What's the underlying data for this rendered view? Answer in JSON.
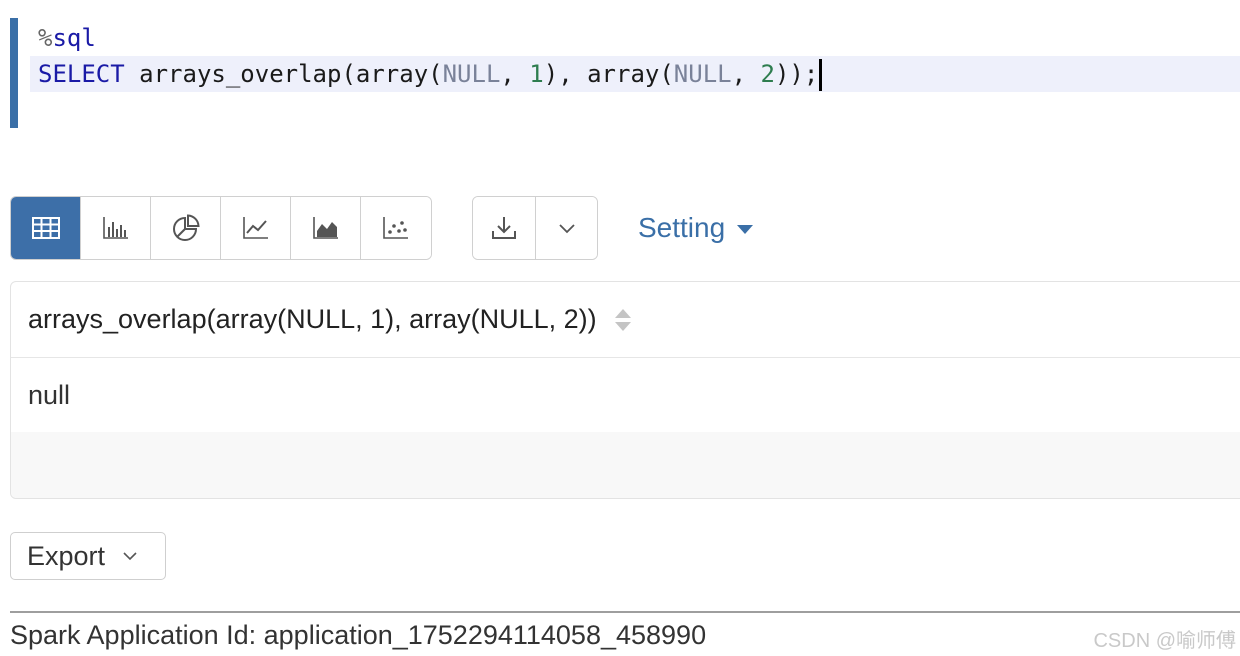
{
  "editor": {
    "magic_pct": "%",
    "magic": "sql",
    "tokens": {
      "kw": "SELECT",
      "fn1": " arrays_overlap(array(",
      "null1": "NULL",
      "sep1": ", ",
      "num1": "1",
      "mid": "), array(",
      "null2": "NULL",
      "sep2": ", ",
      "num2": "2",
      "end": "));"
    }
  },
  "toolbar": {
    "viz_buttons": [
      {
        "icon": "table-icon",
        "active": true
      },
      {
        "icon": "bar-chart-icon",
        "active": false
      },
      {
        "icon": "pie-chart-icon",
        "active": false
      },
      {
        "icon": "line-chart-icon",
        "active": false
      },
      {
        "icon": "area-chart-icon",
        "active": false
      },
      {
        "icon": "scatter-chart-icon",
        "active": false
      }
    ],
    "download_icon": "download-icon",
    "dropdown_icon": "chevron-down-icon",
    "setting_label": "Setting"
  },
  "table": {
    "columns": [
      "arrays_overlap(array(NULL, 1), array(NULL, 2))"
    ],
    "rows": [
      [
        "null"
      ]
    ]
  },
  "export": {
    "label": "Export"
  },
  "footer": {
    "app_id_text": "Spark Application Id: application_1752294114058_458990",
    "watermark": "CSDN @喻师傅"
  },
  "colors": {
    "accent": "#3a6fa7",
    "active_button": "#3d6fa8",
    "line_highlight": "#eef0fb",
    "keyword": "#1a1aa6",
    "null_token": "#7a8299",
    "number_token": "#2e7d4f"
  }
}
